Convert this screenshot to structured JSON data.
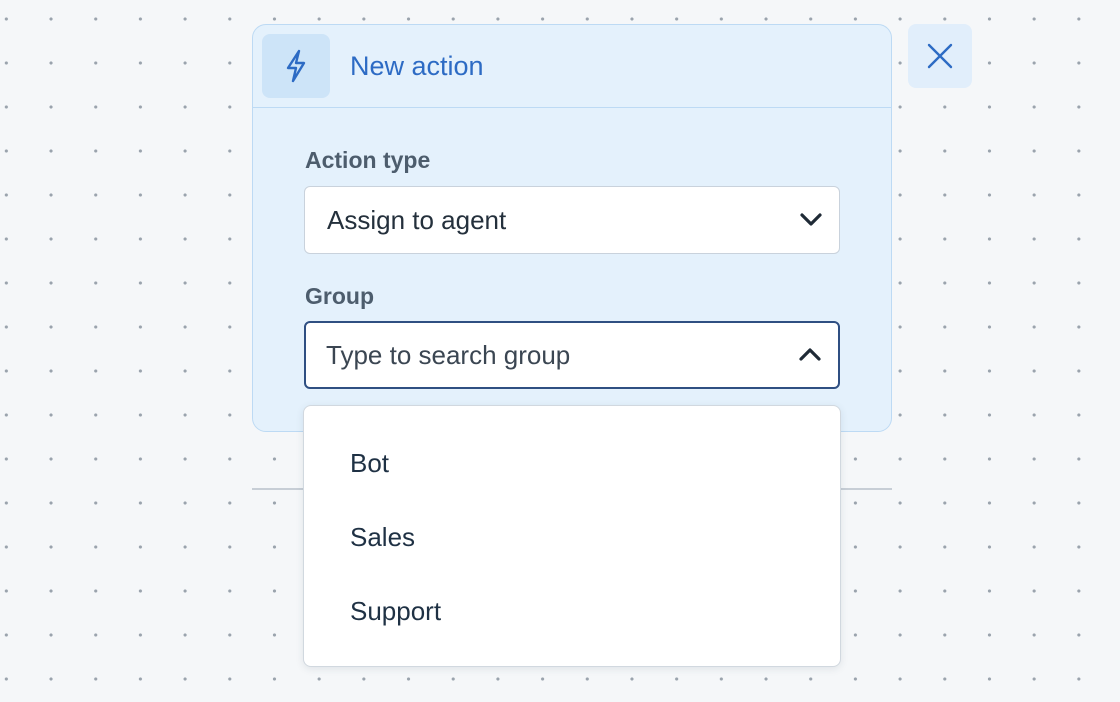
{
  "card": {
    "title": "New action",
    "icon": "lightning-bolt-icon"
  },
  "action_type": {
    "label": "Action type",
    "value": "Assign to agent"
  },
  "group": {
    "label": "Group",
    "placeholder": "Type to search group",
    "options": [
      "Bot",
      "Sales",
      "Support"
    ]
  },
  "colors": {
    "accent": "#2d6bc4",
    "card_bg": "#e4f1fc",
    "focus_border": "#2f4f82"
  }
}
